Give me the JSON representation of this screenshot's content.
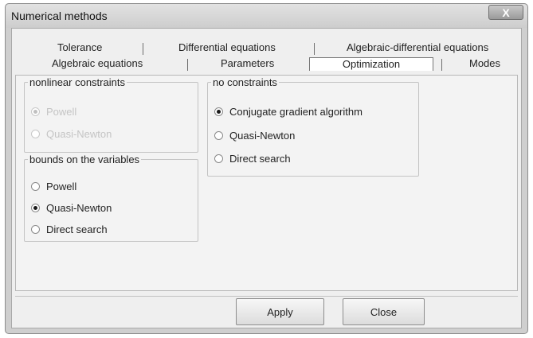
{
  "window": {
    "title": "Numerical methods",
    "close_symbol": "X"
  },
  "tabs": {
    "row1": [
      "Tolerance",
      "Differential equations",
      "Algebraic-differential equations"
    ],
    "row2": [
      "Algebraic equations",
      "Parameters",
      "Optimization",
      "Modes"
    ],
    "active": "Optimization"
  },
  "groups": {
    "nonlinear": {
      "legend": "nonlinear constraints",
      "enabled": false,
      "options": [
        {
          "label": "Powell",
          "checked": true
        },
        {
          "label": "Quasi-Newton",
          "checked": false
        }
      ]
    },
    "bounds": {
      "legend": "bounds on the variables",
      "options": [
        {
          "label": "Powell",
          "checked": false
        },
        {
          "label": "Quasi-Newton",
          "checked": true
        },
        {
          "label": "Direct search",
          "checked": false
        }
      ]
    },
    "none": {
      "legend": "no constraints",
      "options": [
        {
          "label": "Conjugate gradient algorithm",
          "checked": true
        },
        {
          "label": "Quasi-Newton",
          "checked": false
        },
        {
          "label": "Direct search",
          "checked": false
        }
      ]
    }
  },
  "buttons": {
    "apply": "Apply",
    "close": "Close"
  }
}
